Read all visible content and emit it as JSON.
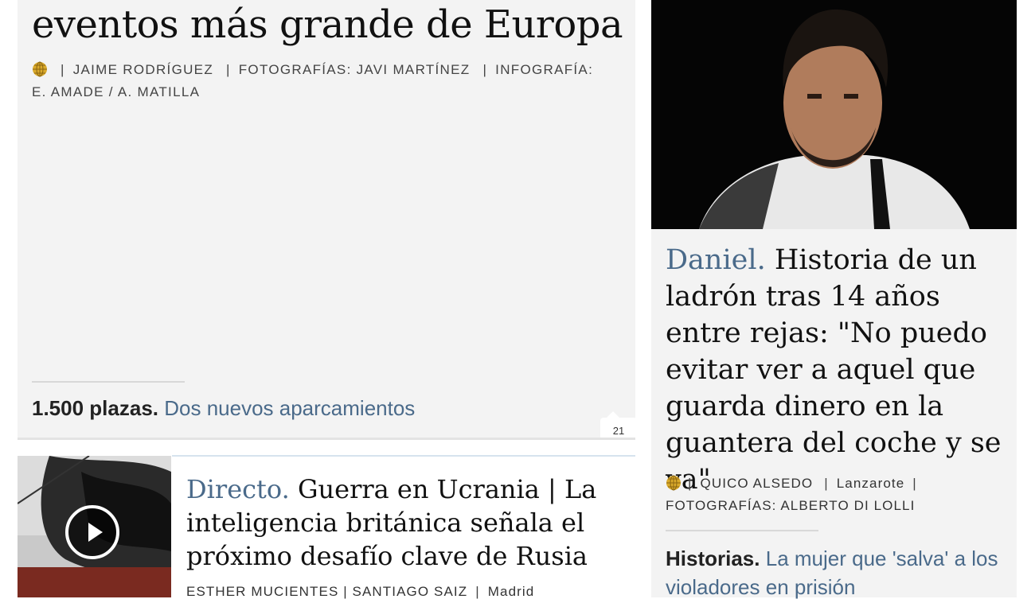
{
  "main_story": {
    "headline": "eventos más grande de Europa",
    "byline": {
      "author": "JAIME RODRÍGUEZ",
      "photos": "FOTOGRAFÍAS: JAVI MARTÍNEZ",
      "infographic_1": "INFOGRAFÍA:",
      "infographic_2": "E. AMADE / A. MATILLA"
    },
    "related": {
      "kicker": "1.500 plazas.",
      "link": "Dos nuevos aparcamientos"
    },
    "comments": "21"
  },
  "second_story": {
    "kicker": "Directo.",
    "headline": "Guerra en Ucrania | La inteligencia británica señala el próximo desafío clave de Rusia",
    "byline": {
      "authors": "ESTHER MUCIENTES | SANTIAGO SAIZ",
      "location": "Madrid"
    }
  },
  "right_story": {
    "kicker": "Daniel.",
    "headline": "Historia de un ladrón tras 14 años entre rejas: \"No puedo evitar ver a aquel que guarda dinero en la guantera del coche y se va\"",
    "byline": {
      "author": "QUICO ALSEDO",
      "location": "Lanzarote",
      "photos": "FOTOGRAFÍAS: ALBERTO DI LOLLI"
    },
    "related": {
      "kicker": "Historias.",
      "link": "La mujer que 'salva' a los violadores en prisión"
    }
  },
  "colors": {
    "link_blue": "#4a6a8a",
    "card_bg": "#f3f3f3"
  }
}
